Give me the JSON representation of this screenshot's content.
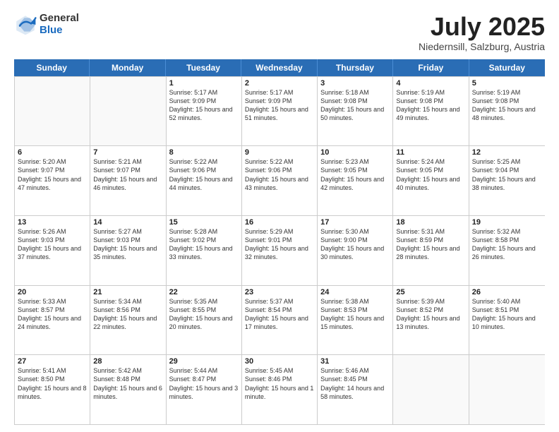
{
  "logo": {
    "general": "General",
    "blue": "Blue"
  },
  "title": "July 2025",
  "location": "Niedernsill, Salzburg, Austria",
  "header_days": [
    "Sunday",
    "Monday",
    "Tuesday",
    "Wednesday",
    "Thursday",
    "Friday",
    "Saturday"
  ],
  "weeks": [
    [
      {
        "day": "",
        "empty": true
      },
      {
        "day": "",
        "empty": true
      },
      {
        "day": "1",
        "sunrise": "Sunrise: 5:17 AM",
        "sunset": "Sunset: 9:09 PM",
        "daylight": "Daylight: 15 hours and 52 minutes."
      },
      {
        "day": "2",
        "sunrise": "Sunrise: 5:17 AM",
        "sunset": "Sunset: 9:09 PM",
        "daylight": "Daylight: 15 hours and 51 minutes."
      },
      {
        "day": "3",
        "sunrise": "Sunrise: 5:18 AM",
        "sunset": "Sunset: 9:08 PM",
        "daylight": "Daylight: 15 hours and 50 minutes."
      },
      {
        "day": "4",
        "sunrise": "Sunrise: 5:19 AM",
        "sunset": "Sunset: 9:08 PM",
        "daylight": "Daylight: 15 hours and 49 minutes."
      },
      {
        "day": "5",
        "sunrise": "Sunrise: 5:19 AM",
        "sunset": "Sunset: 9:08 PM",
        "daylight": "Daylight: 15 hours and 48 minutes."
      }
    ],
    [
      {
        "day": "6",
        "sunrise": "Sunrise: 5:20 AM",
        "sunset": "Sunset: 9:07 PM",
        "daylight": "Daylight: 15 hours and 47 minutes."
      },
      {
        "day": "7",
        "sunrise": "Sunrise: 5:21 AM",
        "sunset": "Sunset: 9:07 PM",
        "daylight": "Daylight: 15 hours and 46 minutes."
      },
      {
        "day": "8",
        "sunrise": "Sunrise: 5:22 AM",
        "sunset": "Sunset: 9:06 PM",
        "daylight": "Daylight: 15 hours and 44 minutes."
      },
      {
        "day": "9",
        "sunrise": "Sunrise: 5:22 AM",
        "sunset": "Sunset: 9:06 PM",
        "daylight": "Daylight: 15 hours and 43 minutes."
      },
      {
        "day": "10",
        "sunrise": "Sunrise: 5:23 AM",
        "sunset": "Sunset: 9:05 PM",
        "daylight": "Daylight: 15 hours and 42 minutes."
      },
      {
        "day": "11",
        "sunrise": "Sunrise: 5:24 AM",
        "sunset": "Sunset: 9:05 PM",
        "daylight": "Daylight: 15 hours and 40 minutes."
      },
      {
        "day": "12",
        "sunrise": "Sunrise: 5:25 AM",
        "sunset": "Sunset: 9:04 PM",
        "daylight": "Daylight: 15 hours and 38 minutes."
      }
    ],
    [
      {
        "day": "13",
        "sunrise": "Sunrise: 5:26 AM",
        "sunset": "Sunset: 9:03 PM",
        "daylight": "Daylight: 15 hours and 37 minutes."
      },
      {
        "day": "14",
        "sunrise": "Sunrise: 5:27 AM",
        "sunset": "Sunset: 9:03 PM",
        "daylight": "Daylight: 15 hours and 35 minutes."
      },
      {
        "day": "15",
        "sunrise": "Sunrise: 5:28 AM",
        "sunset": "Sunset: 9:02 PM",
        "daylight": "Daylight: 15 hours and 33 minutes."
      },
      {
        "day": "16",
        "sunrise": "Sunrise: 5:29 AM",
        "sunset": "Sunset: 9:01 PM",
        "daylight": "Daylight: 15 hours and 32 minutes."
      },
      {
        "day": "17",
        "sunrise": "Sunrise: 5:30 AM",
        "sunset": "Sunset: 9:00 PM",
        "daylight": "Daylight: 15 hours and 30 minutes."
      },
      {
        "day": "18",
        "sunrise": "Sunrise: 5:31 AM",
        "sunset": "Sunset: 8:59 PM",
        "daylight": "Daylight: 15 hours and 28 minutes."
      },
      {
        "day": "19",
        "sunrise": "Sunrise: 5:32 AM",
        "sunset": "Sunset: 8:58 PM",
        "daylight": "Daylight: 15 hours and 26 minutes."
      }
    ],
    [
      {
        "day": "20",
        "sunrise": "Sunrise: 5:33 AM",
        "sunset": "Sunset: 8:57 PM",
        "daylight": "Daylight: 15 hours and 24 minutes."
      },
      {
        "day": "21",
        "sunrise": "Sunrise: 5:34 AM",
        "sunset": "Sunset: 8:56 PM",
        "daylight": "Daylight: 15 hours and 22 minutes."
      },
      {
        "day": "22",
        "sunrise": "Sunrise: 5:35 AM",
        "sunset": "Sunset: 8:55 PM",
        "daylight": "Daylight: 15 hours and 20 minutes."
      },
      {
        "day": "23",
        "sunrise": "Sunrise: 5:37 AM",
        "sunset": "Sunset: 8:54 PM",
        "daylight": "Daylight: 15 hours and 17 minutes."
      },
      {
        "day": "24",
        "sunrise": "Sunrise: 5:38 AM",
        "sunset": "Sunset: 8:53 PM",
        "daylight": "Daylight: 15 hours and 15 minutes."
      },
      {
        "day": "25",
        "sunrise": "Sunrise: 5:39 AM",
        "sunset": "Sunset: 8:52 PM",
        "daylight": "Daylight: 15 hours and 13 minutes."
      },
      {
        "day": "26",
        "sunrise": "Sunrise: 5:40 AM",
        "sunset": "Sunset: 8:51 PM",
        "daylight": "Daylight: 15 hours and 10 minutes."
      }
    ],
    [
      {
        "day": "27",
        "sunrise": "Sunrise: 5:41 AM",
        "sunset": "Sunset: 8:50 PM",
        "daylight": "Daylight: 15 hours and 8 minutes."
      },
      {
        "day": "28",
        "sunrise": "Sunrise: 5:42 AM",
        "sunset": "Sunset: 8:48 PM",
        "daylight": "Daylight: 15 hours and 6 minutes."
      },
      {
        "day": "29",
        "sunrise": "Sunrise: 5:44 AM",
        "sunset": "Sunset: 8:47 PM",
        "daylight": "Daylight: 15 hours and 3 minutes."
      },
      {
        "day": "30",
        "sunrise": "Sunrise: 5:45 AM",
        "sunset": "Sunset: 8:46 PM",
        "daylight": "Daylight: 15 hours and 1 minute."
      },
      {
        "day": "31",
        "sunrise": "Sunrise: 5:46 AM",
        "sunset": "Sunset: 8:45 PM",
        "daylight": "Daylight: 14 hours and 58 minutes."
      },
      {
        "day": "",
        "empty": true
      },
      {
        "day": "",
        "empty": true
      }
    ]
  ]
}
